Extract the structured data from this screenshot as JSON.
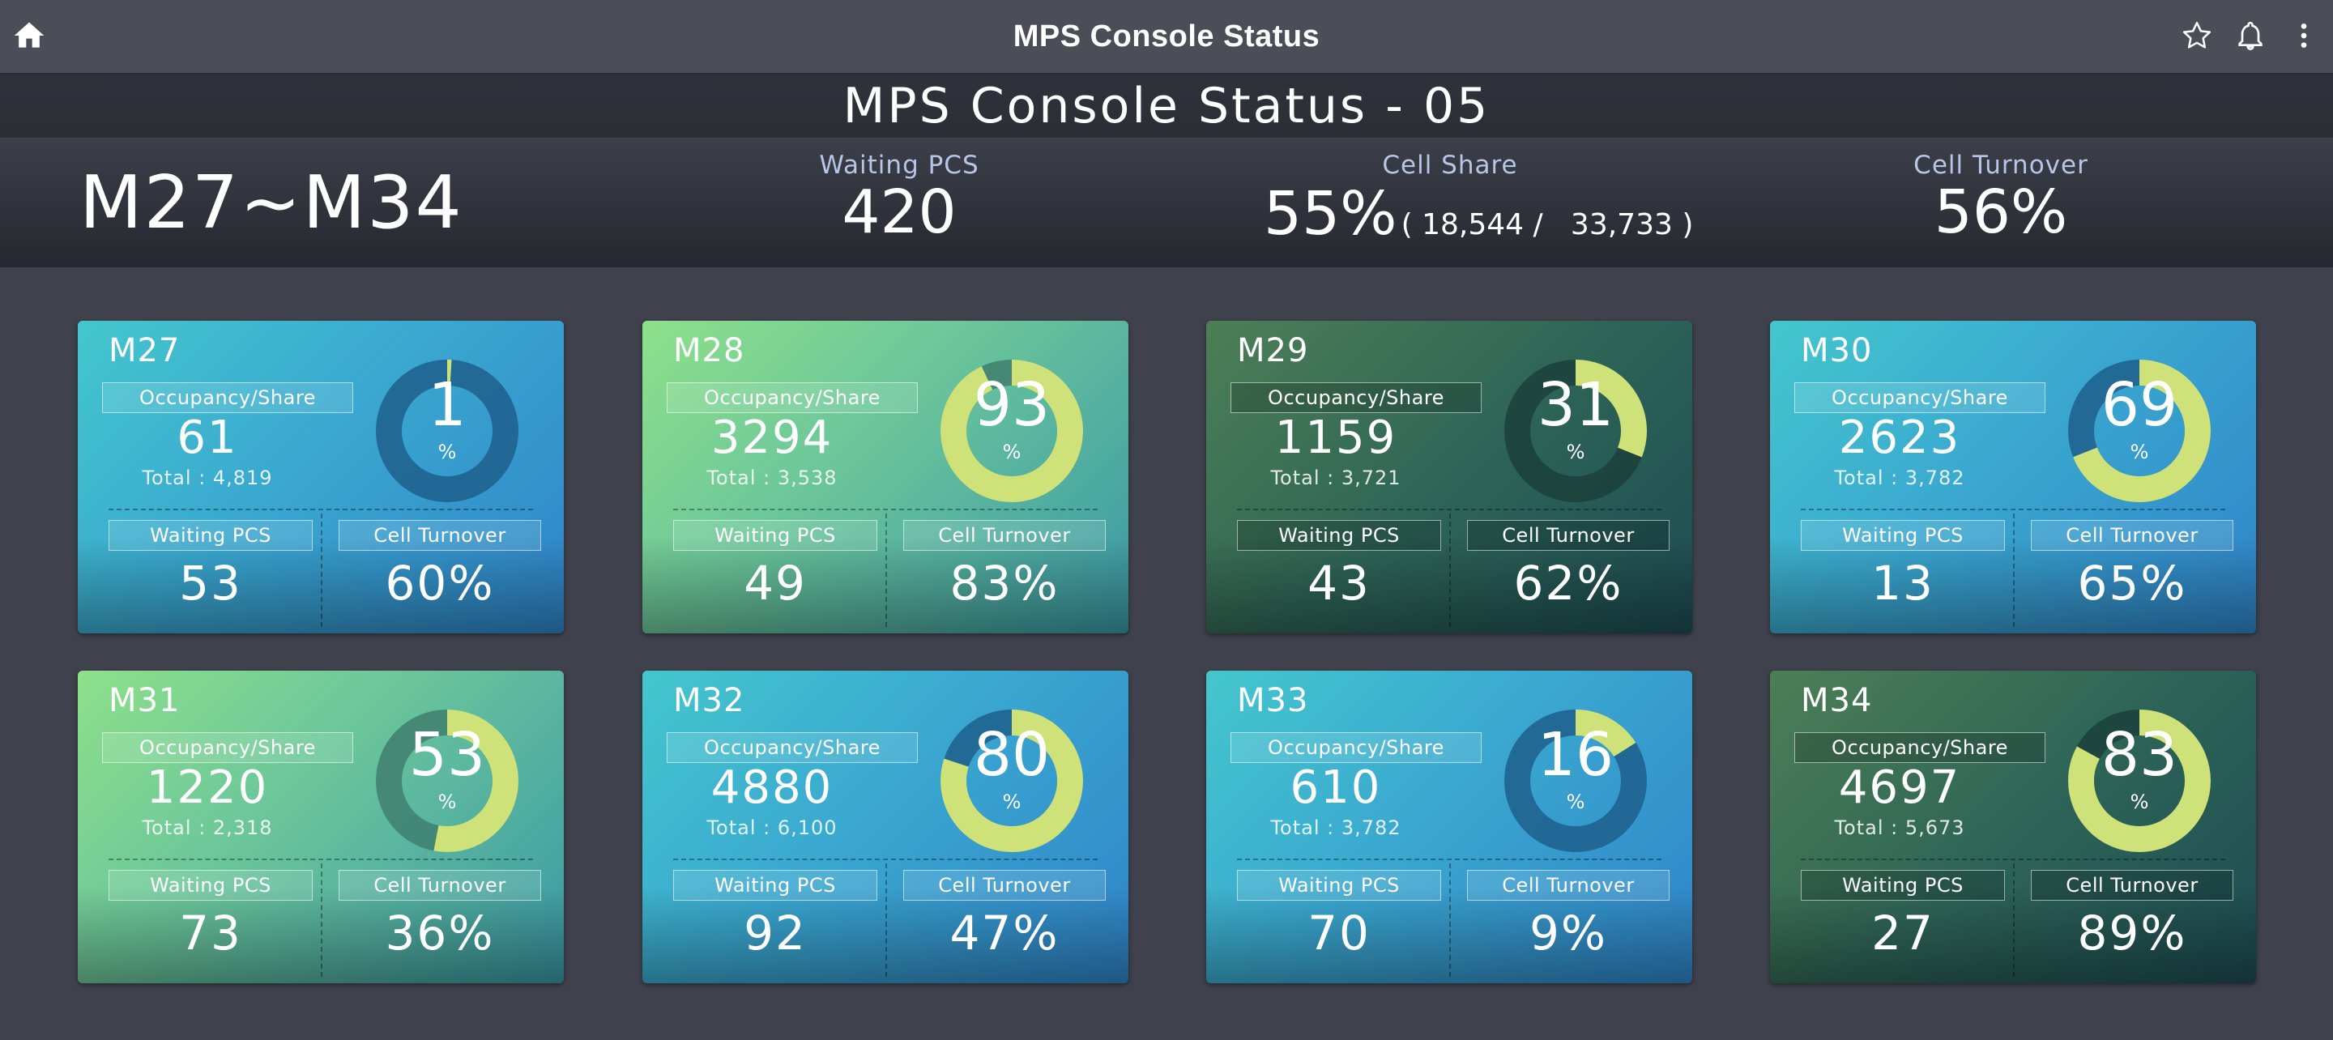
{
  "app": {
    "title": "MPS Console Status",
    "icons": [
      "home-icon",
      "star-icon",
      "bell-icon",
      "more-vert-icon"
    ]
  },
  "header": {
    "title": "MPS Console Status - 05",
    "range": "M27~M34",
    "waiting_label": "Waiting PCS",
    "waiting_value": "420",
    "share_label": "Cell Share",
    "share_value": "55%",
    "share_detail": "( 18,544 /   33,733 )",
    "turnover_label": "Cell Turnover",
    "turnover_value": "56%"
  },
  "labels": {
    "occupancy": "Occupancy/Share",
    "waiting": "Waiting PCS",
    "turnover": "Cell Turnover",
    "percent": "%"
  },
  "colors": {
    "donut_fill": "#cfe27a",
    "ring_blue": "#1f5f8c",
    "ring_green": "#3f7f6e",
    "ring_dark": "#1c3f3b"
  },
  "cards": [
    {
      "name": "M27",
      "theme": "blue",
      "occupancy": "61",
      "total": "Total : 4,819",
      "share_pct": 1,
      "share_text": "1",
      "waiting": "53",
      "turnover": "60%"
    },
    {
      "name": "M28",
      "theme": "green",
      "occupancy": "3294",
      "total": "Total : 3,538",
      "share_pct": 93,
      "share_text": "93",
      "waiting": "49",
      "turnover": "83%"
    },
    {
      "name": "M29",
      "theme": "dark",
      "occupancy": "1159",
      "total": "Total : 3,721",
      "share_pct": 31,
      "share_text": "31",
      "waiting": "43",
      "turnover": "62%"
    },
    {
      "name": "M30",
      "theme": "blue",
      "occupancy": "2623",
      "total": "Total : 3,782",
      "share_pct": 69,
      "share_text": "69",
      "waiting": "13",
      "turnover": "65%"
    },
    {
      "name": "M31",
      "theme": "green",
      "occupancy": "1220",
      "total": "Total : 2,318",
      "share_pct": 53,
      "share_text": "53",
      "waiting": "73",
      "turnover": "36%"
    },
    {
      "name": "M32",
      "theme": "blue",
      "occupancy": "4880",
      "total": "Total : 6,100",
      "share_pct": 80,
      "share_text": "80",
      "waiting": "92",
      "turnover": "47%"
    },
    {
      "name": "M33",
      "theme": "blue",
      "occupancy": "610",
      "total": "Total : 3,782",
      "share_pct": 16,
      "share_text": "16",
      "waiting": "70",
      "turnover": "9%"
    },
    {
      "name": "M34",
      "theme": "dark",
      "occupancy": "4697",
      "total": "Total : 5,673",
      "share_pct": 83,
      "share_text": "83",
      "waiting": "27",
      "turnover": "89%"
    }
  ]
}
